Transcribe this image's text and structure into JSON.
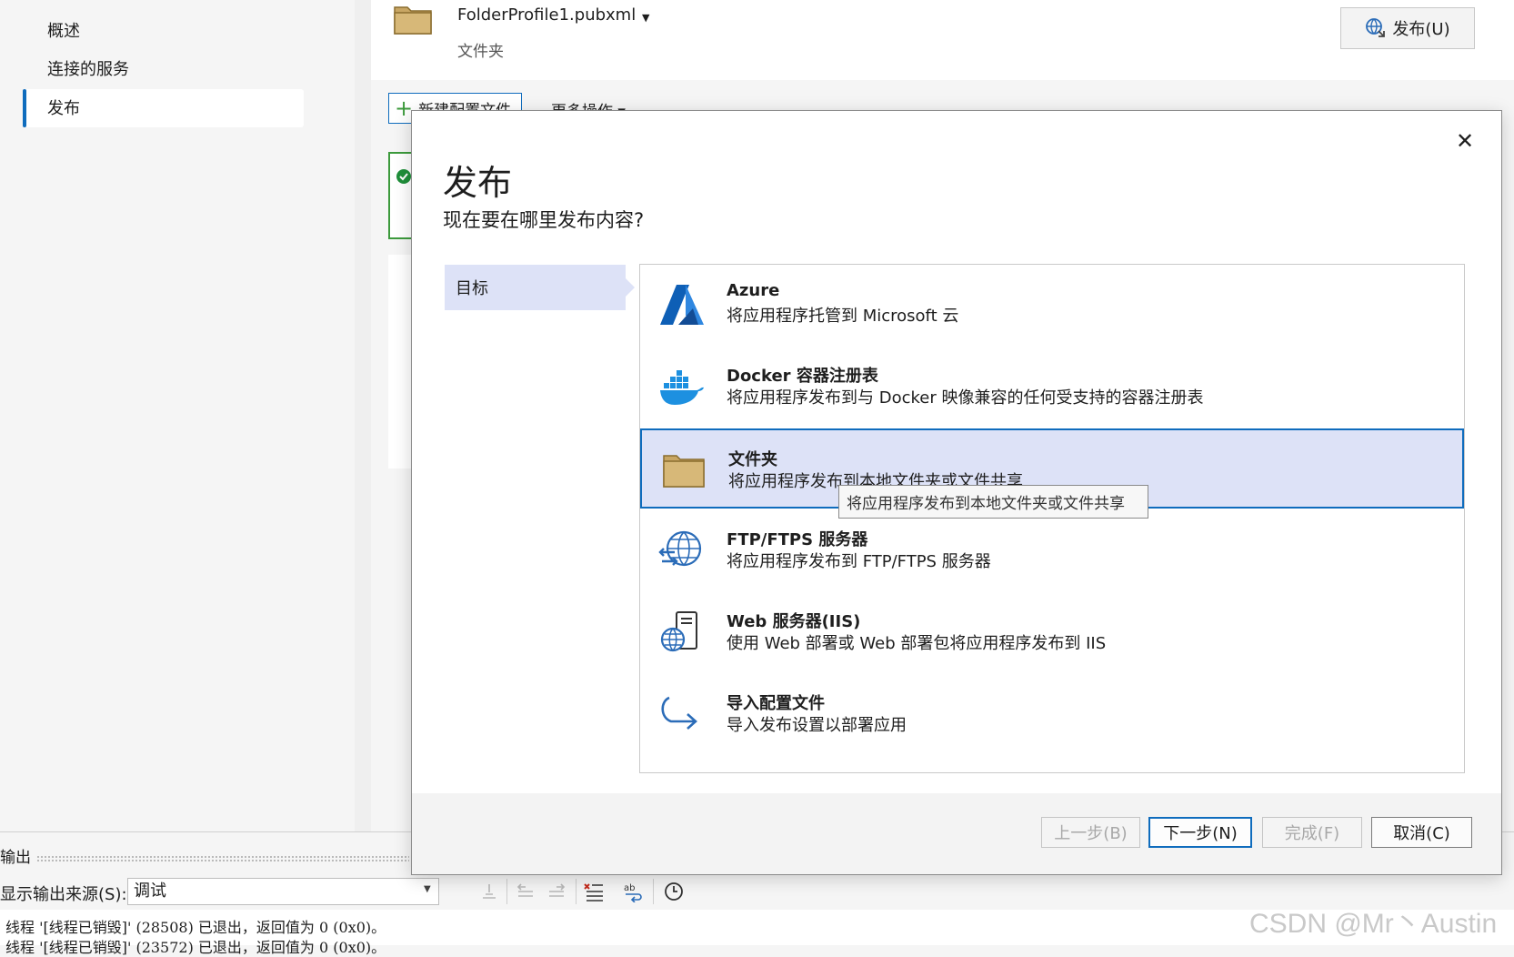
{
  "sidebar": {
    "items": [
      {
        "label": "概述"
      },
      {
        "label": "连接的服务"
      },
      {
        "label": "发布"
      }
    ]
  },
  "profile": {
    "name": "FolderProfile1.pubxml",
    "type": "文件夹",
    "publish_label": "发布(U)"
  },
  "toolbar": {
    "new_profile_label": "新建配置文件",
    "more_actions_label": "更多操作"
  },
  "dialog": {
    "title": "发布",
    "subtitle": "现在要在哪里发布内容?",
    "nav": {
      "target_label": "目标"
    },
    "options": [
      {
        "id": "azure",
        "icon": "azure-icon",
        "title": "Azure",
        "desc": "将应用程序托管到 Microsoft 云"
      },
      {
        "id": "docker",
        "icon": "docker-icon",
        "title": "Docker 容器注册表",
        "desc": "将应用程序发布到与 Docker 映像兼容的任何受支持的容器注册表"
      },
      {
        "id": "folder",
        "icon": "folder-icon",
        "title": "文件夹",
        "desc": "将应用程序发布到本地文件夹或文件共享",
        "selected": true
      },
      {
        "id": "ftp",
        "icon": "ftp-icon",
        "title": "FTP/FTPS 服务器",
        "desc": "将应用程序发布到 FTP/FTPS 服务器"
      },
      {
        "id": "iis",
        "icon": "iis-server-icon",
        "title": "Web 服务器(IIS)",
        "desc": "使用 Web 部署或 Web 部署包将应用程序发布到 IIS"
      },
      {
        "id": "import",
        "icon": "import-arrow-icon",
        "title": "导入配置文件",
        "desc": "导入发布设置以部署应用"
      }
    ],
    "tooltip": "将应用程序发布到本地文件夹或文件共享",
    "buttons": {
      "back": "上一步(B)",
      "next": "下一步(N)",
      "finish": "完成(F)",
      "cancel": "取消(C)"
    }
  },
  "output": {
    "header": "输出",
    "source_label": "显示输出来源(S):",
    "source_value": "调试",
    "lines": [
      "线程 '[线程已销毁]' (28508) 已退出，返回值为 0 (0x0)。",
      "线程 '[线程已销毁]' (23572) 已退出，返回值为 0 (0x0)。"
    ]
  },
  "watermark": "CSDN @Mr丶Austin",
  "colors": {
    "accent": "#0f6cbd",
    "selection": "#dde2f7",
    "folder": "#c8a664"
  }
}
